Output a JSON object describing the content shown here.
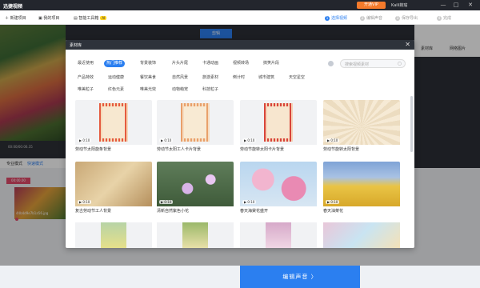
{
  "app": {
    "title": "迅捷视频",
    "vip_label": "开通VIP",
    "user_name": "Kaili婉瑜",
    "win_controls": [
      "—",
      "□",
      "✕"
    ]
  },
  "toolbar": {
    "items": [
      "新建项目",
      "我的项目",
      "智能工具箱"
    ],
    "ai_badge": "AI",
    "steps": [
      {
        "n": "1",
        "label": "选择视频",
        "active": true
      },
      {
        "n": "2",
        "label": "编辑声音",
        "active": false
      },
      {
        "n": "3",
        "label": "保存导出",
        "active": false
      },
      {
        "n": "4",
        "label": "完成",
        "active": false
      }
    ]
  },
  "background": {
    "tab_label": "剪辑",
    "time": "00:00/00:06.35",
    "mode_pro": "专业模式",
    "mode_quick": "快速模式",
    "track_time": "00:00.00",
    "clip_label": "44b4d9e7b1a56.jpg",
    "right_tabs": [
      "素材库",
      "网络图片"
    ],
    "edit_button": "编辑声音 〉"
  },
  "modal": {
    "title": "素材库",
    "close": "✕",
    "search_placeholder": "搜索视频素材",
    "categories_row1": [
      "最近使用",
      "热门推荐",
      "背景装饰",
      "片头片尾",
      "卡通动画",
      "视频转场",
      "搞笑片段"
    ],
    "categories_row2": [
      "产品特效",
      "运动健康",
      "餐饮美食",
      "自然风景",
      "旅游素材",
      "倒计时",
      "城市建筑",
      "天空星空"
    ],
    "categories_row3": [
      "唯美粒子",
      "红色元素",
      "唯美光效",
      "动物萌宠",
      "科技粒子"
    ],
    "active_category": "热门推荐",
    "cards": [
      {
        "duration": "0:10",
        "caption": "劳动节太阳旋条背景"
      },
      {
        "duration": "0:10",
        "caption": "劳动节太阳工人卡片背景"
      },
      {
        "duration": "0:10",
        "caption": "劳动节旋转太阳卡片背景"
      },
      {
        "duration": "0:10",
        "caption": "劳动节旋转太阳背景"
      },
      {
        "duration": "0:10",
        "caption": "复古劳动节工人背景"
      },
      {
        "duration": "0:10",
        "caption": "清新自然紫色小花"
      },
      {
        "duration": "0:10",
        "caption": "春天海棠花盛开"
      },
      {
        "duration": "0:10",
        "caption": "春天油菜花"
      }
    ]
  }
}
